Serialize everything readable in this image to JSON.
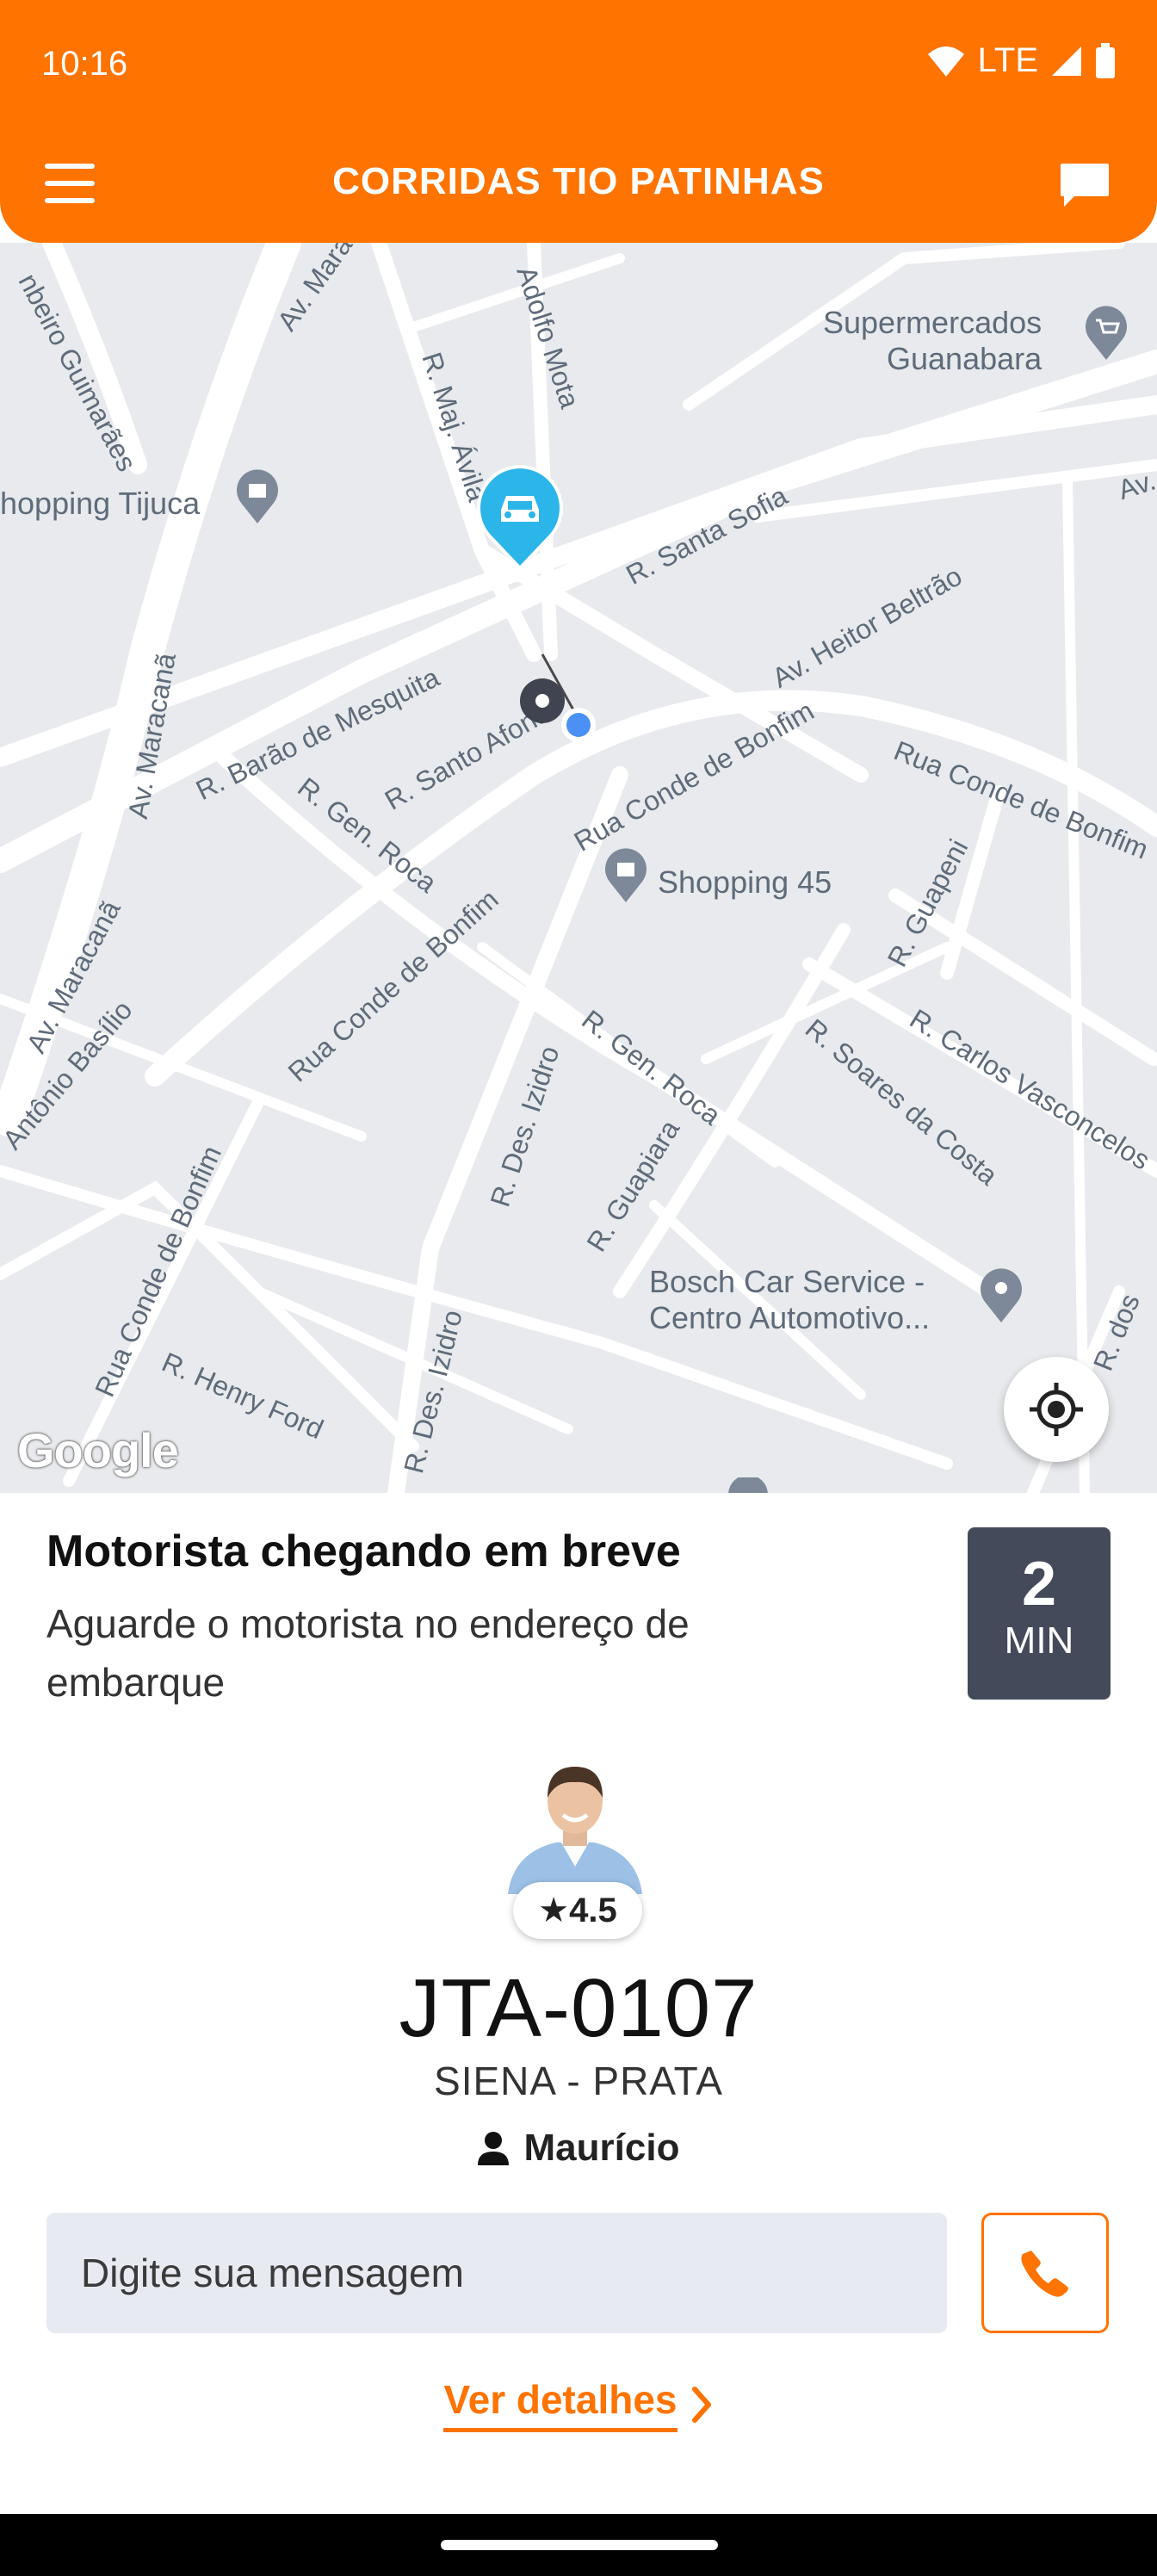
{
  "status_bar": {
    "time": "10:16",
    "network": "LTE"
  },
  "header": {
    "title": "CORRIDAS TIO PATINHAS"
  },
  "map": {
    "pois": {
      "supermercados_1": "Supermercados",
      "supermercados_2": "Guanabara",
      "shopping_tijuca": "hopping Tijuca",
      "shopping_45": "Shopping 45",
      "bosch_1": "Bosch Car Service -",
      "bosch_2": "Centro Automotivo..."
    },
    "streets": {
      "s1": "Av. Mara",
      "s2": "nbeiro Guimarães",
      "s3": "R. Maj. Ávila",
      "s4": "Adolfo Mota",
      "s5": "R. Santa Sofia",
      "s6": "Av. Heitor Beltrão",
      "s7": "R. Barão de Mesquita",
      "s8": "R. Santo Afonso",
      "s9": "Rua Conde de Bonfim",
      "s10": "Rua Conde de Bonfim",
      "s11": "Av. Maracanã",
      "s12": "R. Gen. Roca",
      "s13": "R. Guapeni",
      "s14": "Av. Maracanã",
      "s15": "Antônio Basílio",
      "s16": "Rua Conde de Bonfim",
      "s17": "R. Gen. Roca",
      "s18": "R. Soares da Costa",
      "s19": "R. Carlos Vasconcelos",
      "s20": "R. Des. Izidro",
      "s21": "R. Guapiara",
      "s22": "Rua Conde de Bonfim",
      "s23": "R. Henry Ford",
      "s24": "R. Des. Izidro",
      "s25": "R. dos",
      "s26": "Av."
    },
    "attribution": "Google"
  },
  "ride": {
    "title": "Motorista chegando em breve",
    "subtitle": "Aguarde o motorista no endereço de embarque",
    "eta_value": "2",
    "eta_unit": "MIN"
  },
  "driver": {
    "rating": "4.5",
    "plate": "JTA-0107",
    "car": "SIENA - PRATA",
    "name": "Maurício"
  },
  "message": {
    "placeholder": "Digite sua mensagem"
  },
  "details_link": "Ver detalhes",
  "colors": {
    "primary": "#FF7300",
    "eta_bg": "#454A5A",
    "map_bg": "#E8EAED",
    "car_marker": "#2BB5E8"
  }
}
